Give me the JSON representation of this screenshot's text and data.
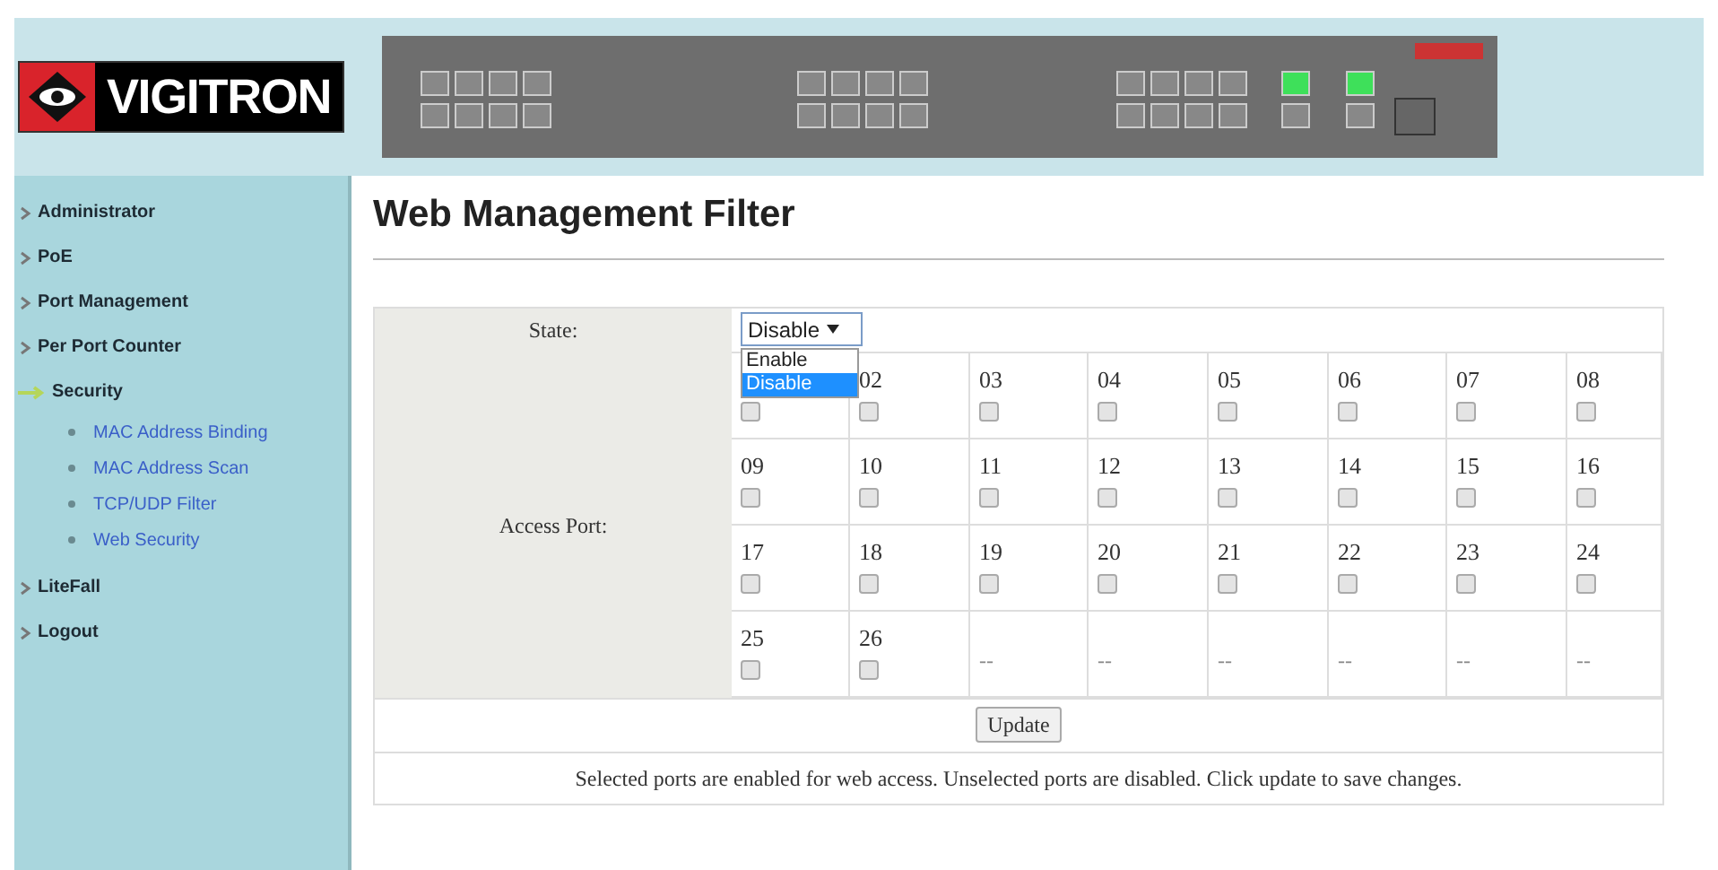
{
  "logo": {
    "text": "VIGITRON"
  },
  "sidebar": {
    "items": [
      {
        "label": "Administrator",
        "expanded": false
      },
      {
        "label": "PoE",
        "expanded": false
      },
      {
        "label": "Port Management",
        "expanded": false
      },
      {
        "label": "Per Port Counter",
        "expanded": false
      },
      {
        "label": "Security",
        "expanded": true,
        "children": [
          {
            "label": "MAC Address Binding"
          },
          {
            "label": "MAC Address Scan"
          },
          {
            "label": "TCP/UDP Filter"
          },
          {
            "label": "Web Security"
          }
        ]
      },
      {
        "label": "LiteFall",
        "expanded": false
      },
      {
        "label": "Logout",
        "expanded": false
      }
    ]
  },
  "page_title": "Web Management Filter",
  "form": {
    "state_label": "State:",
    "state_select": {
      "value": "Disable",
      "expanded": true,
      "options": [
        {
          "label": "Enable",
          "selected": false
        },
        {
          "label": "Disable",
          "selected": true
        }
      ]
    },
    "access_port_label": "Access Port:",
    "ports": [
      {
        "checked": false
      },
      {
        "label": "02",
        "checked": false
      },
      {
        "label": "03",
        "checked": false
      },
      {
        "label": "04",
        "checked": false
      },
      {
        "label": "05",
        "checked": false
      },
      {
        "label": "06",
        "checked": false
      },
      {
        "label": "07",
        "checked": false
      },
      {
        "label": "08",
        "checked": false
      },
      {
        "label": "09",
        "checked": false
      },
      {
        "label": "10",
        "checked": false
      },
      {
        "label": "11",
        "checked": false
      },
      {
        "label": "12",
        "checked": false
      },
      {
        "label": "13",
        "checked": false
      },
      {
        "label": "14",
        "checked": false
      },
      {
        "label": "15",
        "checked": false
      },
      {
        "label": "16",
        "checked": false
      },
      {
        "label": "17",
        "checked": false
      },
      {
        "label": "18",
        "checked": false
      },
      {
        "label": "19",
        "checked": false
      },
      {
        "label": "20",
        "checked": false
      },
      {
        "label": "21",
        "checked": false
      },
      {
        "label": "22",
        "checked": false
      },
      {
        "label": "23",
        "checked": false
      },
      {
        "label": "24",
        "checked": false
      },
      {
        "label": "25",
        "checked": false
      },
      {
        "label": "26",
        "checked": false
      },
      {
        "label": "--",
        "kind": "empty"
      },
      {
        "label": "--",
        "kind": "empty"
      },
      {
        "label": "--",
        "kind": "empty"
      },
      {
        "label": "--",
        "kind": "empty"
      },
      {
        "label": "--",
        "kind": "empty"
      },
      {
        "label": "--",
        "kind": "empty"
      }
    ],
    "update_button": "Update",
    "note": "Selected ports are enabled for web access. Unselected ports are disabled. Click update to save changes."
  }
}
